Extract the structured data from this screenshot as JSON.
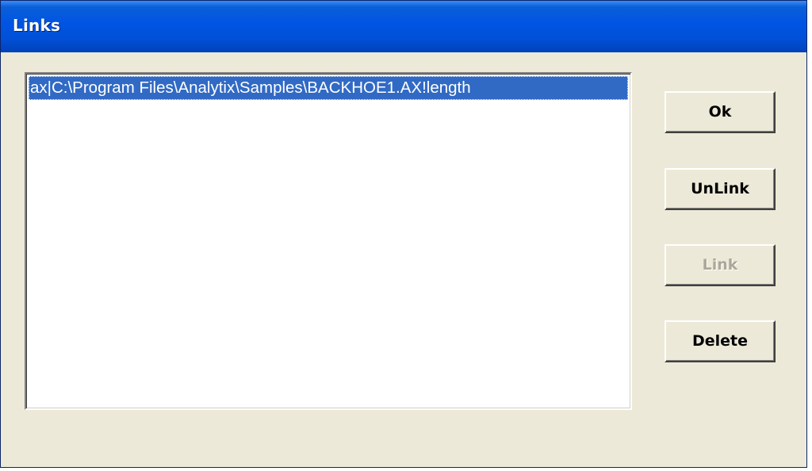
{
  "window": {
    "title": "Links"
  },
  "links_list": {
    "items": [
      {
        "text": "ax|C:\\Program Files\\Analytix\\Samples\\BACKHOE1.AX!length",
        "selected": true
      }
    ]
  },
  "buttons": {
    "ok_label": "Ok",
    "unlink_label": "UnLink",
    "link_label": "Link",
    "delete_label": "Delete",
    "link_enabled": false
  },
  "colors": {
    "title_bar": "#0054e3",
    "dialog_face": "#ece9d8",
    "selection": "#316ac5",
    "disabled_text": "#aca899"
  }
}
